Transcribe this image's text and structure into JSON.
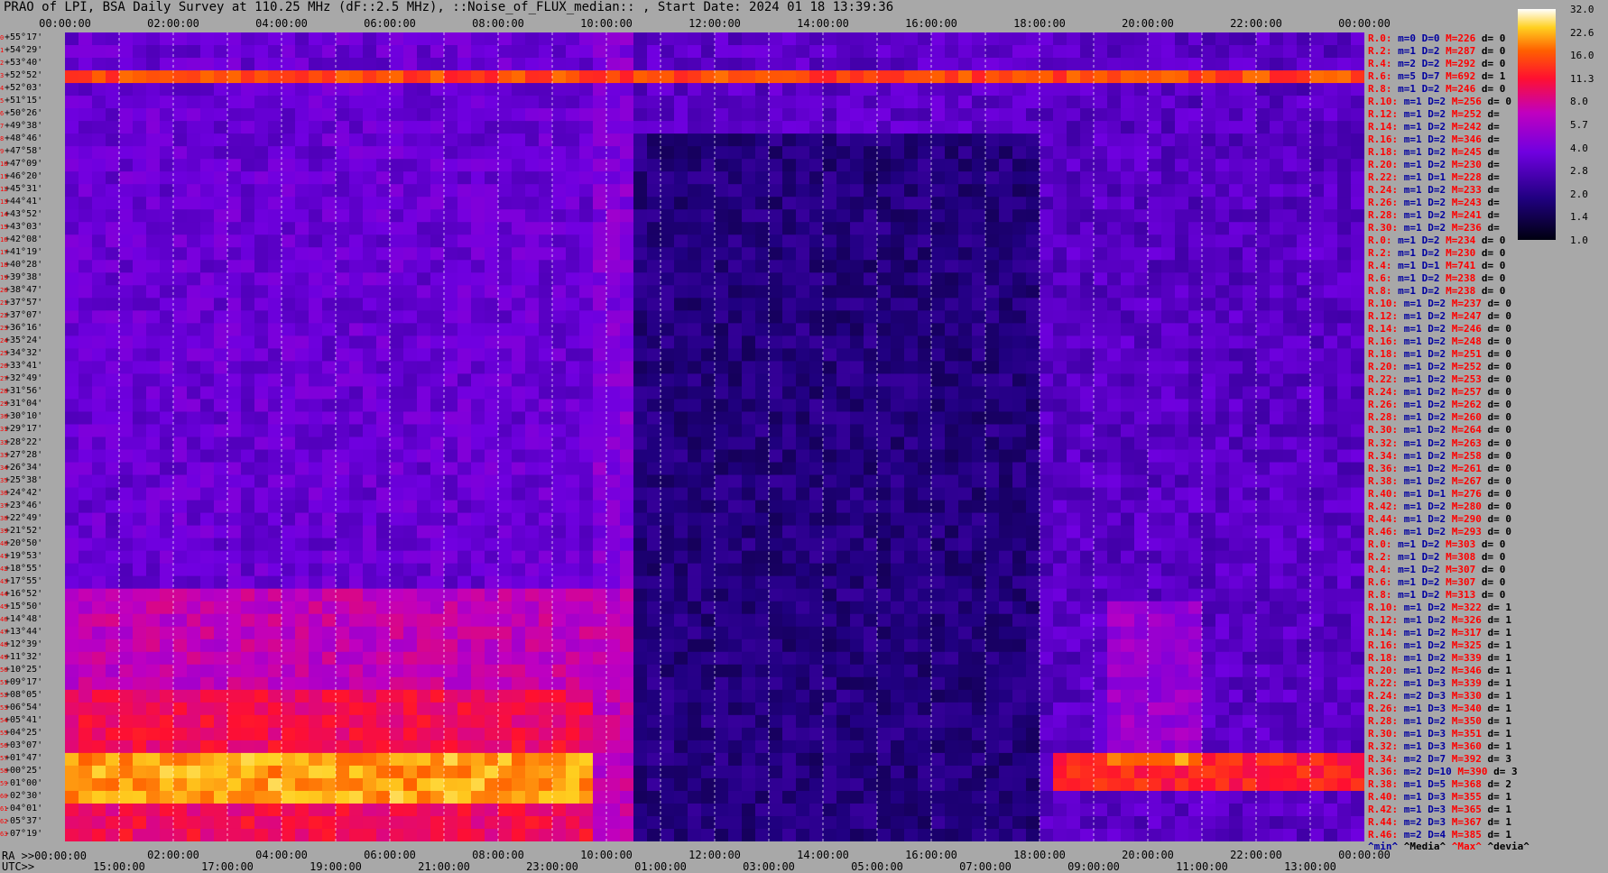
{
  "title": "PRAO of LPI, BSA Daily Survey at 110.25 MHz (dF::2.5 MHz), ::Noise_of_FLUX_median:: , Start Date: 2024 01 18 13:39:36",
  "bottom_ra_prefix": "RA >>00:00:00",
  "bottom_utc_prefix": "UTC>>",
  "legend": {
    "min": "^min^",
    "median": "^Media^",
    "max": "^Max^",
    "devia": "^devia^"
  },
  "colors": {
    "background": "#a8a8a8",
    "stat_name": "#ff0000",
    "stat_blue": "#0000a0",
    "stat_red": "#ff0000"
  },
  "chart_data": {
    "type": "heatmap",
    "title": "PRAO of LPI, BSA Daily Survey at 110.25 MHz (dF::2.5 MHz), ::Noise_of_FLUX_median:: , Start Date: 2024 01 18 13:39:36",
    "x_top_ticks": [
      "00:00:00",
      "02:00:00",
      "04:00:00",
      "06:00:00",
      "08:00:00",
      "10:00:00",
      "12:00:00",
      "14:00:00",
      "16:00:00",
      "18:00:00",
      "20:00:00",
      "22:00:00",
      "00:00:00"
    ],
    "x_ra_ticks": [
      "02:00:00",
      "04:00:00",
      "06:00:00",
      "08:00:00",
      "10:00:00",
      "12:00:00",
      "14:00:00",
      "16:00:00",
      "18:00:00",
      "20:00:00",
      "22:00:00",
      "00:00:00"
    ],
    "x_utc_ticks": [
      "15:00:00",
      "17:00:00",
      "19:00:00",
      "21:00:00",
      "23:00:00",
      "01:00:00",
      "03:00:00",
      "05:00:00",
      "07:00:00",
      "09:00:00",
      "11:00:00",
      "13:00:00"
    ],
    "x_ra_range_hours": [
      0,
      24
    ],
    "y_declination_ticks": [
      "+55°17'",
      "+54°29'",
      "+53°40'",
      "+52°52'",
      "+52°03'",
      "+51°15'",
      "+50°26'",
      "+49°38'",
      "+48°46'",
      "+47°58'",
      "+47°09'",
      "+46°20'",
      "+45°31'",
      "+44°41'",
      "+43°52'",
      "+43°03'",
      "+42°08'",
      "+41°19'",
      "+40°28'",
      "+39°38'",
      "+38°47'",
      "+37°57'",
      "+37°07'",
      "+36°16'",
      "+35°24'",
      "+34°32'",
      "+33°41'",
      "+32°49'",
      "+31°56'",
      "+31°04'",
      "+30°10'",
      "+29°17'",
      "+28°22'",
      "+27°28'",
      "+26°34'",
      "+25°38'",
      "+24°42'",
      "+23°46'",
      "+22°49'",
      "+21°52'",
      "+20°50'",
      "+19°53'",
      "+18°55'",
      "+17°55'",
      "+16°52'",
      "+15°50'",
      "+14°48'",
      "+13°44'",
      "+12°39'",
      "+11°32'",
      "+10°25'",
      "+09°17'",
      "+08°05'",
      "+06°54'",
      "+05°41'",
      "+04°25'",
      "+03°07'",
      "+01°47'",
      "+00°25'",
      "-01°00'",
      "-02°30'",
      "-04°01'",
      "-05°37'",
      "-07°19'"
    ],
    "colorbar": {
      "ticks": [
        "32.0",
        "22.6",
        "16.0",
        "11.3",
        "8.0",
        "5.7",
        "4.0",
        "2.8",
        "2.0",
        "1.4",
        "1.0"
      ],
      "range": [
        1.0,
        32.0
      ],
      "scale": "log"
    },
    "row_stats": [
      {
        "name": "R.0:",
        "m": "0",
        "D": "0",
        "M": "226",
        "d": "0"
      },
      {
        "name": "R.2:",
        "m": "1",
        "D": "2",
        "M": "287",
        "d": "0"
      },
      {
        "name": "R.4:",
        "m": "2",
        "D": "2",
        "M": "292",
        "d": "0"
      },
      {
        "name": "R.6:",
        "m": "5",
        "D": "7",
        "M": "692",
        "d": "1"
      },
      {
        "name": "R.8:",
        "m": "1",
        "D": "2",
        "M": "246",
        "d": "0"
      },
      {
        "name": "R.10:",
        "m": "1",
        "D": "2",
        "M": "256",
        "d": "0"
      },
      {
        "name": "R.12:",
        "m": "1",
        "D": "2",
        "M": "252",
        "d": ""
      },
      {
        "name": "R.14:",
        "m": "1",
        "D": "2",
        "M": "242",
        "d": ""
      },
      {
        "name": "R.16:",
        "m": "1",
        "D": "2",
        "M": "346",
        "d": ""
      },
      {
        "name": "R.18:",
        "m": "1",
        "D": "2",
        "M": "245",
        "d": ""
      },
      {
        "name": "R.20:",
        "m": "1",
        "D": "2",
        "M": "230",
        "d": ""
      },
      {
        "name": "R.22:",
        "m": "1",
        "D": "1",
        "M": "228",
        "d": ""
      },
      {
        "name": "R.24:",
        "m": "1",
        "D": "2",
        "M": "233",
        "d": ""
      },
      {
        "name": "R.26:",
        "m": "1",
        "D": "2",
        "M": "243",
        "d": ""
      },
      {
        "name": "R.28:",
        "m": "1",
        "D": "2",
        "M": "241",
        "d": ""
      },
      {
        "name": "R.30:",
        "m": "1",
        "D": "2",
        "M": "236",
        "d": ""
      },
      {
        "name": "R.0:",
        "m": "1",
        "D": "2",
        "M": "234",
        "d": "0"
      },
      {
        "name": "R.2:",
        "m": "1",
        "D": "2",
        "M": "230",
        "d": "0"
      },
      {
        "name": "R.4:",
        "m": "1",
        "D": "1",
        "M": "741",
        "d": "0"
      },
      {
        "name": "R.6:",
        "m": "1",
        "D": "2",
        "M": "238",
        "d": "0"
      },
      {
        "name": "R.8:",
        "m": "1",
        "D": "2",
        "M": "238",
        "d": "0"
      },
      {
        "name": "R.10:",
        "m": "1",
        "D": "2",
        "M": "237",
        "d": "0"
      },
      {
        "name": "R.12:",
        "m": "1",
        "D": "2",
        "M": "247",
        "d": "0"
      },
      {
        "name": "R.14:",
        "m": "1",
        "D": "2",
        "M": "246",
        "d": "0"
      },
      {
        "name": "R.16:",
        "m": "1",
        "D": "2",
        "M": "248",
        "d": "0"
      },
      {
        "name": "R.18:",
        "m": "1",
        "D": "2",
        "M": "251",
        "d": "0"
      },
      {
        "name": "R.20:",
        "m": "1",
        "D": "2",
        "M": "252",
        "d": "0"
      },
      {
        "name": "R.22:",
        "m": "1",
        "D": "2",
        "M": "253",
        "d": "0"
      },
      {
        "name": "R.24:",
        "m": "1",
        "D": "2",
        "M": "257",
        "d": "0"
      },
      {
        "name": "R.26:",
        "m": "1",
        "D": "2",
        "M": "262",
        "d": "0"
      },
      {
        "name": "R.28:",
        "m": "1",
        "D": "2",
        "M": "260",
        "d": "0"
      },
      {
        "name": "R.30:",
        "m": "1",
        "D": "2",
        "M": "264",
        "d": "0"
      },
      {
        "name": "R.32:",
        "m": "1",
        "D": "2",
        "M": "263",
        "d": "0"
      },
      {
        "name": "R.34:",
        "m": "1",
        "D": "2",
        "M": "258",
        "d": "0"
      },
      {
        "name": "R.36:",
        "m": "1",
        "D": "2",
        "M": "261",
        "d": "0"
      },
      {
        "name": "R.38:",
        "m": "1",
        "D": "2",
        "M": "267",
        "d": "0"
      },
      {
        "name": "R.40:",
        "m": "1",
        "D": "1",
        "M": "276",
        "d": "0"
      },
      {
        "name": "R.42:",
        "m": "1",
        "D": "2",
        "M": "280",
        "d": "0"
      },
      {
        "name": "R.44:",
        "m": "1",
        "D": "2",
        "M": "290",
        "d": "0"
      },
      {
        "name": "R.46:",
        "m": "1",
        "D": "2",
        "M": "293",
        "d": "0"
      },
      {
        "name": "R.0:",
        "m": "1",
        "D": "2",
        "M": "303",
        "d": "0"
      },
      {
        "name": "R.2:",
        "m": "1",
        "D": "2",
        "M": "308",
        "d": "0"
      },
      {
        "name": "R.4:",
        "m": "1",
        "D": "2",
        "M": "307",
        "d": "0"
      },
      {
        "name": "R.6:",
        "m": "1",
        "D": "2",
        "M": "307",
        "d": "0"
      },
      {
        "name": "R.8:",
        "m": "1",
        "D": "2",
        "M": "313",
        "d": "0"
      },
      {
        "name": "R.10:",
        "m": "1",
        "D": "2",
        "M": "322",
        "d": "1"
      },
      {
        "name": "R.12:",
        "m": "1",
        "D": "2",
        "M": "326",
        "d": "1"
      },
      {
        "name": "R.14:",
        "m": "1",
        "D": "2",
        "M": "317",
        "d": "1"
      },
      {
        "name": "R.16:",
        "m": "1",
        "D": "2",
        "M": "325",
        "d": "1"
      },
      {
        "name": "R.18:",
        "m": "1",
        "D": "2",
        "M": "339",
        "d": "1"
      },
      {
        "name": "R.20:",
        "m": "1",
        "D": "2",
        "M": "346",
        "d": "1"
      },
      {
        "name": "R.22:",
        "m": "1",
        "D": "3",
        "M": "339",
        "d": "1"
      },
      {
        "name": "R.24:",
        "m": "2",
        "D": "3",
        "M": "330",
        "d": "1"
      },
      {
        "name": "R.26:",
        "m": "1",
        "D": "3",
        "M": "340",
        "d": "1"
      },
      {
        "name": "R.28:",
        "m": "1",
        "D": "2",
        "M": "350",
        "d": "1"
      },
      {
        "name": "R.30:",
        "m": "1",
        "D": "3",
        "M": "351",
        "d": "1"
      },
      {
        "name": "R.32:",
        "m": "1",
        "D": "3",
        "M": "360",
        "d": "1"
      },
      {
        "name": "R.34:",
        "m": "2",
        "D": "7",
        "M": "392",
        "d": "3"
      },
      {
        "name": "R.36:",
        "m": "2",
        "D": "10",
        "M": "390",
        "d": "3"
      },
      {
        "name": "R.38:",
        "m": "1",
        "D": "5",
        "M": "368",
        "d": "2"
      },
      {
        "name": "R.40:",
        "m": "1",
        "D": "3",
        "M": "355",
        "d": "1"
      },
      {
        "name": "R.42:",
        "m": "1",
        "D": "3",
        "M": "365",
        "d": "1"
      },
      {
        "name": "R.44:",
        "m": "2",
        "D": "3",
        "M": "367",
        "d": "1"
      },
      {
        "name": "R.46:",
        "m": "2",
        "D": "4",
        "M": "385",
        "d": "1"
      }
    ]
  }
}
